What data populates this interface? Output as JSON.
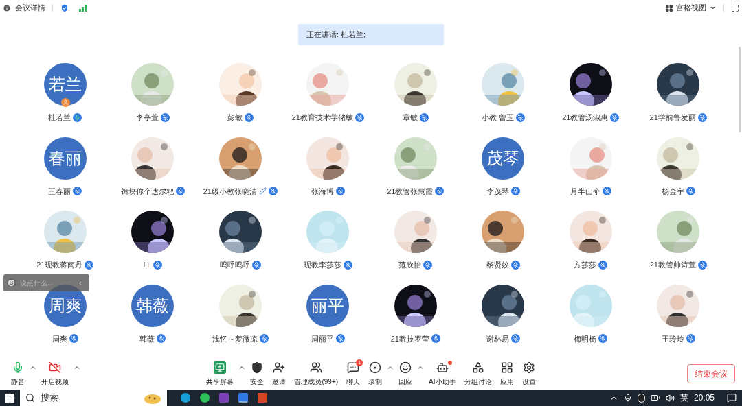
{
  "top_bar": {
    "meeting_info": "会议详情",
    "view_menu": "宫格视图"
  },
  "speaker_banner": "正在讲话: 杜若兰;",
  "participants": [
    {
      "name": "杜若兰",
      "avatar": {
        "kind": "text",
        "text": "若兰"
      },
      "muted": false,
      "host": true
    },
    {
      "name": "李亭萱",
      "muted": true
    },
    {
      "name": "彭敏",
      "muted": true
    },
    {
      "name": "21教育技术学储敏",
      "muted": true
    },
    {
      "name": "章敏",
      "muted": true
    },
    {
      "name": "小教 曾玉",
      "muted": true
    },
    {
      "name": "21教管汤淑惠",
      "muted": true
    },
    {
      "name": "21学前鲁发丽",
      "muted": true
    },
    {
      "name": "王春丽",
      "avatar": {
        "kind": "text",
        "text": "春丽"
      },
      "muted": true
    },
    {
      "name": "饵块你个达尔粑",
      "muted": true
    },
    {
      "name": "21级小教张晓清",
      "muted": true,
      "renamed": true
    },
    {
      "name": "张海博",
      "muted": true
    },
    {
      "name": "21教管张慧霞",
      "muted": true
    },
    {
      "name": "李茂琴",
      "avatar": {
        "kind": "text",
        "text": "茂琴"
      },
      "muted": true
    },
    {
      "name": "月半山伞",
      "muted": true
    },
    {
      "name": "杨金宇",
      "muted": true
    },
    {
      "name": "21现教蒋南丹",
      "muted": true
    },
    {
      "name": "Li.",
      "muted": true
    },
    {
      "name": "呜呼呜呼",
      "muted": true
    },
    {
      "name": "现教李莎莎",
      "muted": true
    },
    {
      "name": "范欣怡",
      "muted": true
    },
    {
      "name": "黎贤姣",
      "muted": true
    },
    {
      "name": "方莎莎",
      "muted": true
    },
    {
      "name": "21教管帅诗萱",
      "muted": true
    },
    {
      "name": "周爽",
      "avatar": {
        "kind": "text",
        "text": "周爽"
      },
      "muted": true
    },
    {
      "name": "韩薇",
      "avatar": {
        "kind": "text",
        "text": "韩薇"
      },
      "muted": true
    },
    {
      "name": "浅忆～梦微凉",
      "muted": true
    },
    {
      "name": "周丽平",
      "avatar": {
        "kind": "text",
        "text": "丽平"
      },
      "muted": true
    },
    {
      "name": "21教技罗莹",
      "muted": true
    },
    {
      "name": "谢林易",
      "muted": true
    },
    {
      "name": "梅明杨",
      "muted": true
    },
    {
      "name": "王玲玲",
      "muted": true
    }
  ],
  "chat_input": {
    "placeholder": "说点什么...",
    "collapse": "‹"
  },
  "toolbar_left": [
    {
      "label": "静音",
      "kind": "mic",
      "caret": true
    },
    {
      "label": "开启视频",
      "kind": "video",
      "caret": true
    }
  ],
  "toolbar_center": [
    {
      "label": "共享屏幕",
      "kind": "share",
      "caret": true
    },
    {
      "label": "安全",
      "kind": "shield"
    },
    {
      "label": "邀请",
      "kind": "invite"
    },
    {
      "label": "管理成员(99+)",
      "kind": "members"
    },
    {
      "label": "聊天",
      "kind": "chat",
      "badge": "1"
    },
    {
      "label": "录制",
      "kind": "record",
      "caret": true
    },
    {
      "label": "回应",
      "kind": "react",
      "caret": true
    },
    {
      "label": "AI小助手",
      "kind": "ai",
      "dot": true
    },
    {
      "label": "分组讨论",
      "kind": "breakout"
    },
    {
      "label": "应用",
      "kind": "apps"
    },
    {
      "label": "设置",
      "kind": "settings"
    }
  ],
  "end_button": "结束会议",
  "taskbar": {
    "search": "搜索",
    "input_method": "英",
    "time": "20:05"
  }
}
